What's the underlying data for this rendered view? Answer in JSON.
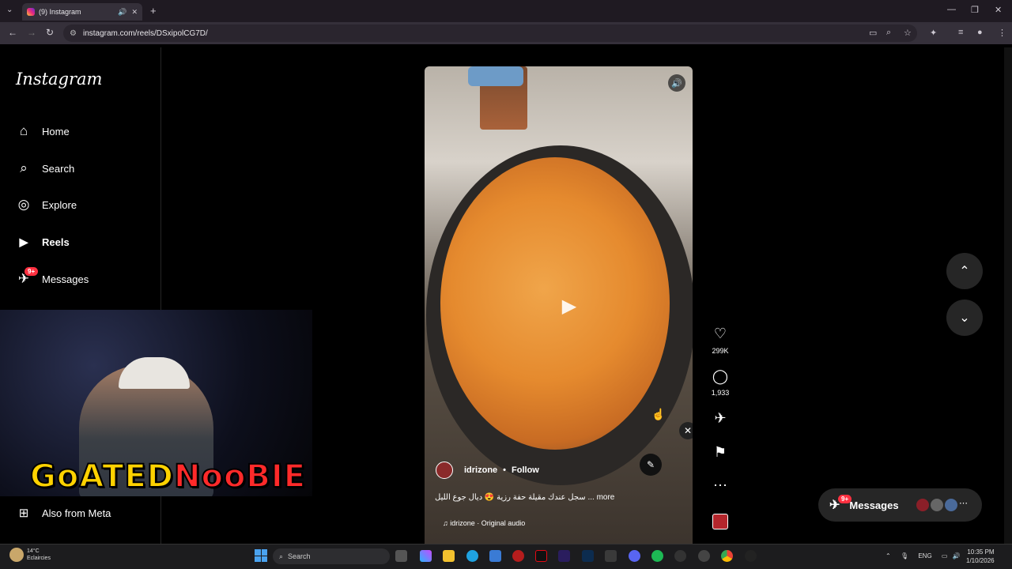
{
  "browser": {
    "tab_title": "(9) Instagram",
    "url": "instagram.com/reels/DSxipolCG7D/"
  },
  "sidebar": {
    "logo": "Instagram",
    "items": [
      {
        "label": "Home",
        "icon": "home-icon"
      },
      {
        "label": "Search",
        "icon": "search-icon"
      },
      {
        "label": "Explore",
        "icon": "compass-icon"
      },
      {
        "label": "Reels",
        "icon": "reels-icon"
      },
      {
        "label": "Messages",
        "icon": "messenger-icon",
        "badge": "9+"
      }
    ],
    "also_from_meta": "Also from Meta"
  },
  "webcam": {
    "overlay_part1": "GoATED",
    "overlay_part2": "NooBIE"
  },
  "reel": {
    "username": "idrizone",
    "separator": "•",
    "follow_label": "Follow",
    "caption": "سجل عندك مقيلة حفة رزية 😍 ديال جوع الليل ... more",
    "audio": "idrizone · Original audio",
    "likes": "299K",
    "comments": "1,933"
  },
  "messages_pill": {
    "label": "Messages",
    "badge": "9+"
  },
  "taskbar": {
    "weather_temp": "14°C",
    "weather_desc": "Eclaircies",
    "search_placeholder": "Search",
    "lang": "ENG",
    "time": "10:35 PM",
    "date": "1/10/2026"
  },
  "colors": {
    "ig_badge": "#ff3040",
    "overlay_yellow": "#ffd200",
    "overlay_red": "#ff2a2a"
  }
}
